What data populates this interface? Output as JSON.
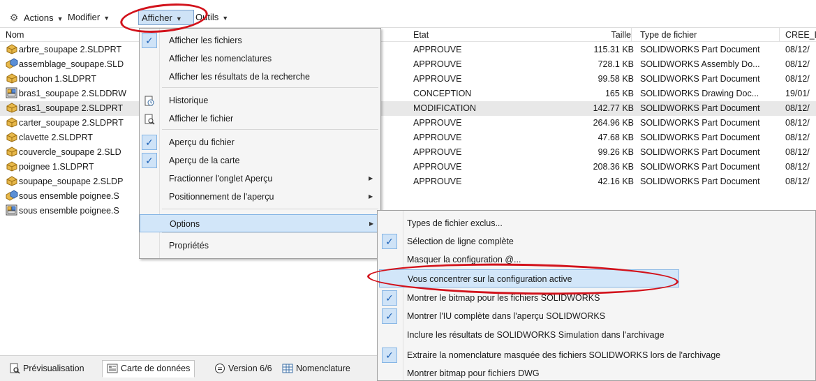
{
  "toolbar": {
    "actions": "Actions",
    "modifier": "Modifier",
    "afficher": "Afficher",
    "outils": "Outils"
  },
  "columns": {
    "nom": "Nom",
    "etat": "Etat",
    "taille": "Taille",
    "type": "Type de fichier",
    "cree": "CREE_L"
  },
  "files": [
    {
      "name": "arbre_soupape 2.SLDPRT",
      "state": "APPROUVE",
      "size": "115.31 KB",
      "type": "SOLIDWORKS Part Document",
      "date": "08/12/",
      "icon": "part-icon"
    },
    {
      "name": "assemblage_soupape.SLD",
      "state": "APPROUVE",
      "size": "728.1 KB",
      "type": "SOLIDWORKS Assembly Do...",
      "date": "08/12/",
      "icon": "assembly-icon"
    },
    {
      "name": "bouchon 1.SLDPRT",
      "state": "APPROUVE",
      "size": "99.58 KB",
      "type": "SOLIDWORKS Part Document",
      "date": "08/12/",
      "icon": "part-icon"
    },
    {
      "name": "bras1_soupape 2.SLDDRW",
      "state": "CONCEPTION",
      "size": "165 KB",
      "type": "SOLIDWORKS Drawing Doc...",
      "date": "19/01/",
      "icon": "drawing-icon"
    },
    {
      "name": "bras1_soupape 2.SLDPRT",
      "state": "MODIFICATION",
      "size": "142.77 KB",
      "type": "SOLIDWORKS Part Document",
      "date": "08/12/",
      "icon": "part-icon"
    },
    {
      "name": "carter_soupape 2.SLDPRT",
      "state": "APPROUVE",
      "size": "264.96 KB",
      "type": "SOLIDWORKS Part Document",
      "date": "08/12/",
      "icon": "part-icon"
    },
    {
      "name": "clavette 2.SLDPRT",
      "state": "APPROUVE",
      "size": "47.68 KB",
      "type": "SOLIDWORKS Part Document",
      "date": "08/12/",
      "icon": "part-icon"
    },
    {
      "name": "couvercle_soupape 2.SLD",
      "state": "APPROUVE",
      "size": "99.26 KB",
      "type": "SOLIDWORKS Part Document",
      "date": "08/12/",
      "icon": "part-icon"
    },
    {
      "name": "poignee 1.SLDPRT",
      "state": "APPROUVE",
      "size": "208.36 KB",
      "type": "SOLIDWORKS Part Document",
      "date": "08/12/",
      "icon": "part-icon"
    },
    {
      "name": "soupape_soupape 2.SLDP",
      "state": "APPROUVE",
      "size": "42.16 KB",
      "type": "SOLIDWORKS Part Document",
      "date": "08/12/",
      "icon": "part-icon"
    },
    {
      "name": "sous ensemble poignee.S",
      "state": "",
      "size": "",
      "type": "",
      "date": "",
      "icon": "assembly-icon"
    },
    {
      "name": "sous ensemble poignee.S",
      "state": "",
      "size": "",
      "type": "",
      "date": "",
      "icon": "drawing-icon"
    }
  ],
  "afficher_menu": [
    {
      "label": "Afficher les fichiers",
      "checked": true
    },
    {
      "label": "Afficher les nomenclatures",
      "checked": false
    },
    {
      "label": "Afficher les résultats de la recherche",
      "checked": false
    },
    {
      "label": "Historique",
      "checked": false,
      "icon": "history-icon"
    },
    {
      "label": "Afficher le fichier",
      "checked": false,
      "icon": "view-file-icon"
    },
    {
      "label": "Aperçu du fichier",
      "checked": true
    },
    {
      "label": "Aperçu de la carte",
      "checked": true
    },
    {
      "label": "Fractionner l'onglet Aperçu",
      "checked": false,
      "submenu": true
    },
    {
      "label": "Positionnement de l'aperçu",
      "checked": false,
      "submenu": true
    },
    {
      "label": "Options",
      "checked": false,
      "submenu": true,
      "highlighted": true
    },
    {
      "label": "Propriétés",
      "checked": false
    }
  ],
  "options_menu": [
    {
      "label": "Types de fichier exclus...",
      "checked": false
    },
    {
      "label": "Sélection de ligne complète",
      "checked": true
    },
    {
      "label": "Masquer la configuration @...",
      "checked": false
    },
    {
      "label": "Vous concentrer sur la configuration active",
      "checked": false,
      "highlighted": true
    },
    {
      "label": "Montrer le bitmap pour les fichiers SOLIDWORKS",
      "checked": true
    },
    {
      "label": "Montrer l'IU complète dans l'aperçu SOLIDWORKS",
      "checked": true
    },
    {
      "label": "Inclure les résultats de SOLIDWORKS Simulation dans l'archivage",
      "checked": false
    },
    {
      "label": "Extraire la nomenclature masquée des fichiers SOLIDWORKS lors de l'archivage",
      "checked": true
    },
    {
      "label": "Montrer bitmap pour fichiers DWG",
      "checked": false
    }
  ],
  "tabs": {
    "preview": "Prévisualisation",
    "datacard": "Carte de données",
    "version": "Version 6/6",
    "bom": "Nomenclature"
  },
  "colors": {
    "highlight": "#d2e6f9",
    "check": "#1a5fb4",
    "annotation": "#d2121b"
  }
}
